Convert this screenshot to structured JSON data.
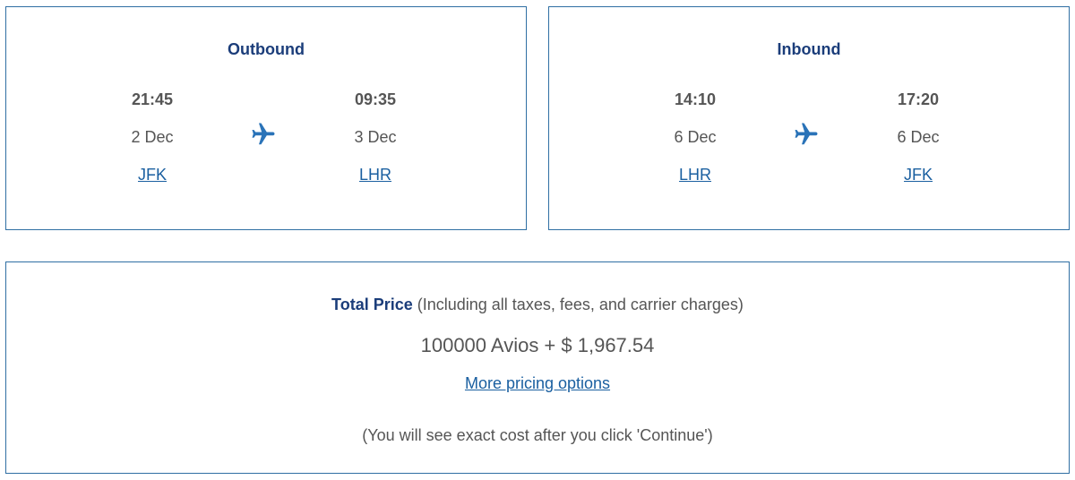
{
  "outbound": {
    "title": "Outbound",
    "departure": {
      "time": "21:45",
      "date": "2 Dec",
      "airport": "JFK"
    },
    "arrival": {
      "time": "09:35",
      "date": "3 Dec",
      "airport": "LHR"
    },
    "icon": "airplane-icon"
  },
  "inbound": {
    "title": "Inbound",
    "departure": {
      "time": "14:10",
      "date": "6 Dec",
      "airport": "LHR"
    },
    "arrival": {
      "time": "17:20",
      "date": "6 Dec",
      "airport": "JFK"
    },
    "icon": "airplane-icon"
  },
  "pricing": {
    "label": "Total Price",
    "label_note": " (Including all taxes, fees, and carrier charges)",
    "value": "100000 Avios + $ 1,967.54",
    "more_options_link": "More pricing options",
    "note": "(You will see exact cost after you click 'Continue')"
  },
  "colors": {
    "border": "#2f6fa3",
    "title": "#1b3d7a",
    "link": "#1a5fa0",
    "text": "#555555",
    "plane": "#2a73b8"
  }
}
